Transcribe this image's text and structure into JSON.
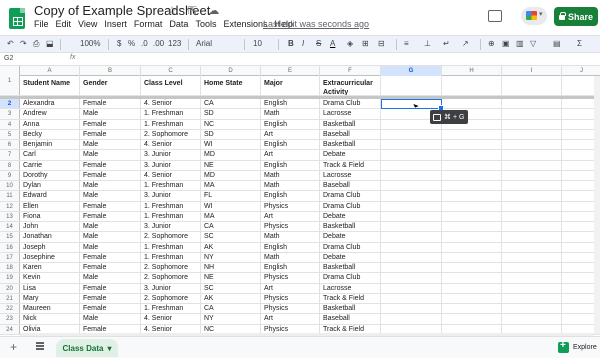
{
  "app": {
    "doc_title": "Copy of Example Spreadsheet",
    "last_edit": "Last edit was seconds ago",
    "share_label": "Share",
    "title_icons": "☆ ⇱ ☁"
  },
  "menu": [
    "File",
    "Edit",
    "View",
    "Insert",
    "Format",
    "Data",
    "Tools",
    "Extensions",
    "Help"
  ],
  "toolbar": {
    "undo": "↶",
    "redo": "↷",
    "print": "⎙",
    "paint": "⬓",
    "zoom": "100%",
    "currency": "$",
    "percent": "%",
    "dec_down": ".0",
    "dec_up": ".00",
    "more_formats": "123",
    "font": "Arial",
    "font_size": "10",
    "bold": "B",
    "italic": "I",
    "strike": "S",
    "text_color": "A",
    "fill": "◈",
    "borders": "⊞",
    "merge": "⊟",
    "align": "≡",
    "valign": "⊥",
    "wrap": "↵",
    "rotate": "↗",
    "link": "⊕",
    "comment": "▣",
    "chart": "▥",
    "filter": "▽",
    "views": "▤",
    "functions": "Σ"
  },
  "formula_bar": {
    "name_box": "G2",
    "fx": "fx",
    "value": ""
  },
  "columns": [
    "A",
    "B",
    "C",
    "D",
    "E",
    "F",
    "G",
    "H",
    "I",
    "J"
  ],
  "selected_cell": "G2",
  "header_row": [
    "Student Name",
    "Gender",
    "Class Level",
    "Home State",
    "Major",
    "Extracurricular Activity"
  ],
  "rows": [
    [
      "Alexandra",
      "Female",
      "4. Senior",
      "CA",
      "English",
      "Drama Club"
    ],
    [
      "Andrew",
      "Male",
      "1. Freshman",
      "SD",
      "Math",
      "Lacrosse"
    ],
    [
      "Anna",
      "Female",
      "1. Freshman",
      "NC",
      "English",
      "Basketball"
    ],
    [
      "Becky",
      "Female",
      "2. Sophomore",
      "SD",
      "Art",
      "Baseball"
    ],
    [
      "Benjamin",
      "Male",
      "4. Senior",
      "WI",
      "English",
      "Basketball"
    ],
    [
      "Carl",
      "Male",
      "3. Junior",
      "MD",
      "Art",
      "Debate"
    ],
    [
      "Carrie",
      "Female",
      "3. Junior",
      "NE",
      "English",
      "Track & Field"
    ],
    [
      "Dorothy",
      "Female",
      "4. Senior",
      "MD",
      "Math",
      "Lacrosse"
    ],
    [
      "Dylan",
      "Male",
      "1. Freshman",
      "MA",
      "Math",
      "Baseball"
    ],
    [
      "Edward",
      "Male",
      "3. Junior",
      "FL",
      "English",
      "Drama Club"
    ],
    [
      "Ellen",
      "Female",
      "1. Freshman",
      "WI",
      "Physics",
      "Drama Club"
    ],
    [
      "Fiona",
      "Female",
      "1. Freshman",
      "MA",
      "Art",
      "Debate"
    ],
    [
      "John",
      "Male",
      "3. Junior",
      "CA",
      "Physics",
      "Basketball"
    ],
    [
      "Jonathan",
      "Male",
      "2. Sophomore",
      "SC",
      "Math",
      "Debate"
    ],
    [
      "Joseph",
      "Male",
      "1. Freshman",
      "AK",
      "English",
      "Drama Club"
    ],
    [
      "Josephine",
      "Female",
      "1. Freshman",
      "NY",
      "Math",
      "Debate"
    ],
    [
      "Karen",
      "Female",
      "2. Sophomore",
      "NH",
      "English",
      "Basketball"
    ],
    [
      "Kevin",
      "Male",
      "2. Sophomore",
      "NE",
      "Physics",
      "Drama Club"
    ],
    [
      "Lisa",
      "Female",
      "3. Junior",
      "SC",
      "Art",
      "Lacrosse"
    ],
    [
      "Mary",
      "Female",
      "2. Sophomore",
      "AK",
      "Physics",
      "Track & Field"
    ],
    [
      "Maureen",
      "Female",
      "1. Freshman",
      "CA",
      "Physics",
      "Basketball"
    ],
    [
      "Nick",
      "Male",
      "4. Senior",
      "NY",
      "Art",
      "Baseball"
    ],
    [
      "Olivia",
      "Female",
      "4. Senior",
      "NC",
      "Physics",
      "Track & Field"
    ]
  ],
  "tooltip": {
    "shortcut": "⌘ + G"
  },
  "sheet_tab": {
    "label": "Class Data",
    "caret": "▾"
  },
  "bottom": {
    "add_sheet": "+",
    "explore_label": "Explore"
  }
}
